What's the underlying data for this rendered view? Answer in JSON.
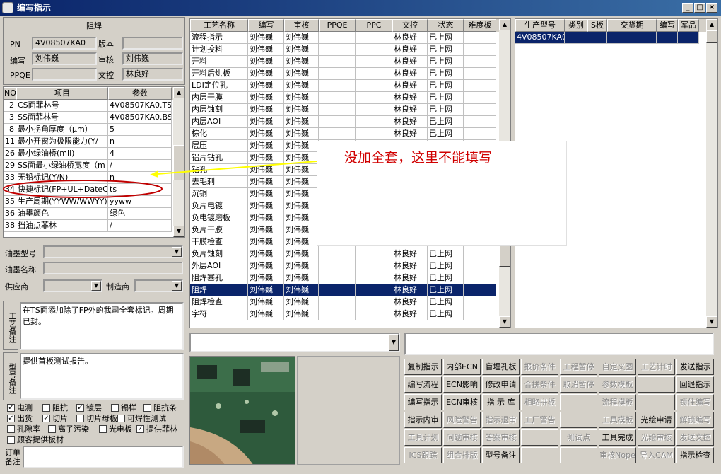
{
  "window": {
    "title": "编写指示",
    "min": "_",
    "max": "□",
    "close": "×"
  },
  "left": {
    "section_title": "阻焊",
    "pn_label": "PN",
    "pn_value": "4V08507KA0",
    "version_label": "版本",
    "version_value": "",
    "author_label": "编写",
    "author_value": "刘伟巍",
    "review_label": "审核",
    "review_value": "刘伟巍",
    "ppqe_label": "PPQE",
    "ppqe_value": "",
    "doc_label": "文控",
    "doc_value": "林良好",
    "param_headers": [
      "NO",
      "项目",
      "参数"
    ],
    "params": [
      {
        "no": "2",
        "item": "CS面菲林号",
        "value": "4V08507KA0.TS"
      },
      {
        "no": "3",
        "item": "SS面菲林号",
        "value": "4V08507KA0.BS"
      },
      {
        "no": "8",
        "item": "最小拐角厚度（μm）",
        "value": "5"
      },
      {
        "no": "11",
        "item": "最小开窗为极限能力(Y/",
        "value": "n"
      },
      {
        "no": "26",
        "item": "最小绿油桥(mil)",
        "value": "4"
      },
      {
        "no": "29",
        "item": "SS面最小绿油桥宽度（m",
        "value": "/"
      },
      {
        "no": "33",
        "item": "无铅标记(Y/N)",
        "value": "n"
      },
      {
        "no": "34",
        "item": "快捷标记(FP+UL+DateCo",
        "value": "ts"
      },
      {
        "no": "35",
        "item": "生产周期(YYWW/WWYY)",
        "value": "yyww"
      },
      {
        "no": "36",
        "item": "油墨颜色",
        "value": "绿色"
      },
      {
        "no": "38",
        "item": "挡油点菲林",
        "value": "/"
      }
    ],
    "ink_type_label": "油墨型号",
    "ink_type_value": "",
    "ink_name_label": "油墨名称",
    "ink_name_value": "",
    "supplier_label": "供应商",
    "supplier_value": "",
    "maker_label": "制造商",
    "maker_value": "",
    "process_note_label": "工艺备注",
    "process_note": "在TS面添加除了FP外的我司全套标记。周期已封。",
    "model_note_label": "型号备注",
    "model_note": "提供首板测试报告。",
    "checks": [
      {
        "label": "电测",
        "checked": true
      },
      {
        "label": "阻抗",
        "checked": false
      },
      {
        "label": "镀层",
        "checked": true
      },
      {
        "label": "锡样",
        "checked": false
      },
      {
        "label": "阻抗条",
        "checked": false
      },
      {
        "label": "出货",
        "checked": true
      },
      {
        "label": "切片",
        "checked": true
      },
      {
        "label": "切片母板",
        "checked": false
      },
      {
        "label": "可焊性测试",
        "checked": false
      },
      {
        "label": "孔隙率",
        "checked": false
      },
      {
        "label": "离子污染",
        "checked": false
      },
      {
        "label": "光电板",
        "checked": false
      },
      {
        "label": "提供菲林",
        "checked": true
      },
      {
        "label": "顾客提供板材",
        "checked": false
      }
    ],
    "order_note_label": "订单备注"
  },
  "process": {
    "headers": [
      "工艺名称",
      "编写",
      "审核",
      "PPQE",
      "PPC",
      "文控",
      "状态",
      "难度板"
    ],
    "rows": [
      [
        "流程指示",
        "刘伟巍",
        "刘伟巍",
        "",
        "",
        "林良好",
        "已上网",
        ""
      ],
      [
        "计划投料",
        "刘伟巍",
        "刘伟巍",
        "",
        "",
        "林良好",
        "已上网",
        ""
      ],
      [
        "开料",
        "刘伟巍",
        "刘伟巍",
        "",
        "",
        "林良好",
        "已上网",
        ""
      ],
      [
        "开料后烘板",
        "刘伟巍",
        "刘伟巍",
        "",
        "",
        "林良好",
        "已上网",
        ""
      ],
      [
        "LDI定位孔",
        "刘伟巍",
        "刘伟巍",
        "",
        "",
        "林良好",
        "已上网",
        ""
      ],
      [
        "内层干膜",
        "刘伟巍",
        "刘伟巍",
        "",
        "",
        "林良好",
        "已上网",
        ""
      ],
      [
        "内层蚀刻",
        "刘伟巍",
        "刘伟巍",
        "",
        "",
        "林良好",
        "已上网",
        ""
      ],
      [
        "内层AOI",
        "刘伟巍",
        "刘伟巍",
        "",
        "",
        "林良好",
        "已上网",
        ""
      ],
      [
        "棕化",
        "刘伟巍",
        "刘伟巍",
        "",
        "",
        "林良好",
        "已上网",
        ""
      ],
      [
        "层压",
        "刘伟巍",
        "刘伟巍",
        "",
        "",
        "",
        "",
        ""
      ],
      [
        "铝片钻孔",
        "刘伟巍",
        "刘伟巍",
        "",
        "",
        "",
        "",
        ""
      ],
      [
        "钻孔",
        "刘伟巍",
        "刘伟巍",
        "",
        "",
        "",
        "",
        ""
      ],
      [
        "去毛刺",
        "刘伟巍",
        "刘伟巍",
        "",
        "",
        "",
        "",
        ""
      ],
      [
        "沉铜",
        "刘伟巍",
        "刘伟巍",
        "",
        "",
        "",
        "",
        ""
      ],
      [
        "负片电镀",
        "刘伟巍",
        "刘伟巍",
        "",
        "",
        "",
        "",
        ""
      ],
      [
        "负电镀磨板",
        "刘伟巍",
        "刘伟巍",
        "",
        "",
        "",
        "",
        ""
      ],
      [
        "负片干膜",
        "刘伟巍",
        "刘伟巍",
        "",
        "",
        "",
        "",
        ""
      ],
      [
        "干膜检查",
        "刘伟巍",
        "刘伟巍",
        "",
        "",
        "",
        "",
        ""
      ],
      [
        "负片蚀刻",
        "刘伟巍",
        "刘伟巍",
        "",
        "",
        "林良好",
        "已上网",
        ""
      ],
      [
        "外层AOI",
        "刘伟巍",
        "刘伟巍",
        "",
        "",
        "林良好",
        "已上网",
        ""
      ],
      [
        "阻焊塞孔",
        "刘伟巍",
        "刘伟巍",
        "",
        "",
        "林良好",
        "已上网",
        ""
      ],
      [
        "阻焊",
        "刘伟巍",
        "刘伟巍",
        "",
        "",
        "林良好",
        "已上网",
        ""
      ],
      [
        "阻焊检查",
        "刘伟巍",
        "刘伟巍",
        "",
        "",
        "林良好",
        "已上网",
        ""
      ],
      [
        "字符",
        "刘伟巍",
        "刘伟巍",
        "",
        "",
        "林良好",
        "已上网",
        ""
      ]
    ],
    "selected_index": 21
  },
  "production": {
    "headers": [
      "生产型号",
      "类别",
      "S板",
      "交货期",
      "编写",
      "军品"
    ],
    "rows": [
      [
        "4V08507KA0",
        "",
        "",
        "",
        "",
        ""
      ]
    ]
  },
  "annotation": "没加全套，这里不能填写",
  "buttons": [
    [
      "复制指示",
      "内部ECN",
      "盲埋孔板",
      "报价条件",
      "工程暂停",
      "自定义图",
      "工艺计时",
      "发送指示"
    ],
    [
      "编写流程",
      "ECN影响",
      "修改申请",
      "合拼条件",
      "取消暂停",
      "参数模板",
      "",
      "回退指示"
    ],
    [
      "编写指示",
      "ECN审核",
      "指 示 库",
      "相略拼板",
      "",
      "流程模板",
      "",
      "锁住编写"
    ],
    [
      "指示内审",
      "风险警告",
      "指示退审",
      "工厂警告",
      "",
      "工具模板",
      "光绘申请",
      "解锁编写"
    ],
    [
      "工具计划",
      "问题审核",
      "答案审核",
      "",
      "测试点",
      "工具完成",
      "光绘审核",
      "发送文控"
    ],
    [
      "ICS跟踪",
      "组合排版",
      "型号备注",
      "",
      "",
      "审核Nope",
      "导入CAM",
      "指示检查"
    ]
  ],
  "buttons_disabled": [
    [
      false,
      false,
      false,
      true,
      true,
      true,
      true,
      false
    ],
    [
      false,
      false,
      false,
      true,
      true,
      true,
      false,
      false
    ],
    [
      false,
      false,
      false,
      true,
      false,
      true,
      false,
      true
    ],
    [
      false,
      true,
      true,
      true,
      false,
      true,
      false,
      true
    ],
    [
      true,
      true,
      true,
      false,
      true,
      false,
      true,
      true
    ],
    [
      true,
      true,
      false,
      false,
      false,
      true,
      true,
      false
    ]
  ],
  "colors": {
    "annotation_text": "#d00000",
    "arrow": "#ffff00",
    "highlight_ellipse": "#c00000",
    "selection": "#0a246a"
  }
}
